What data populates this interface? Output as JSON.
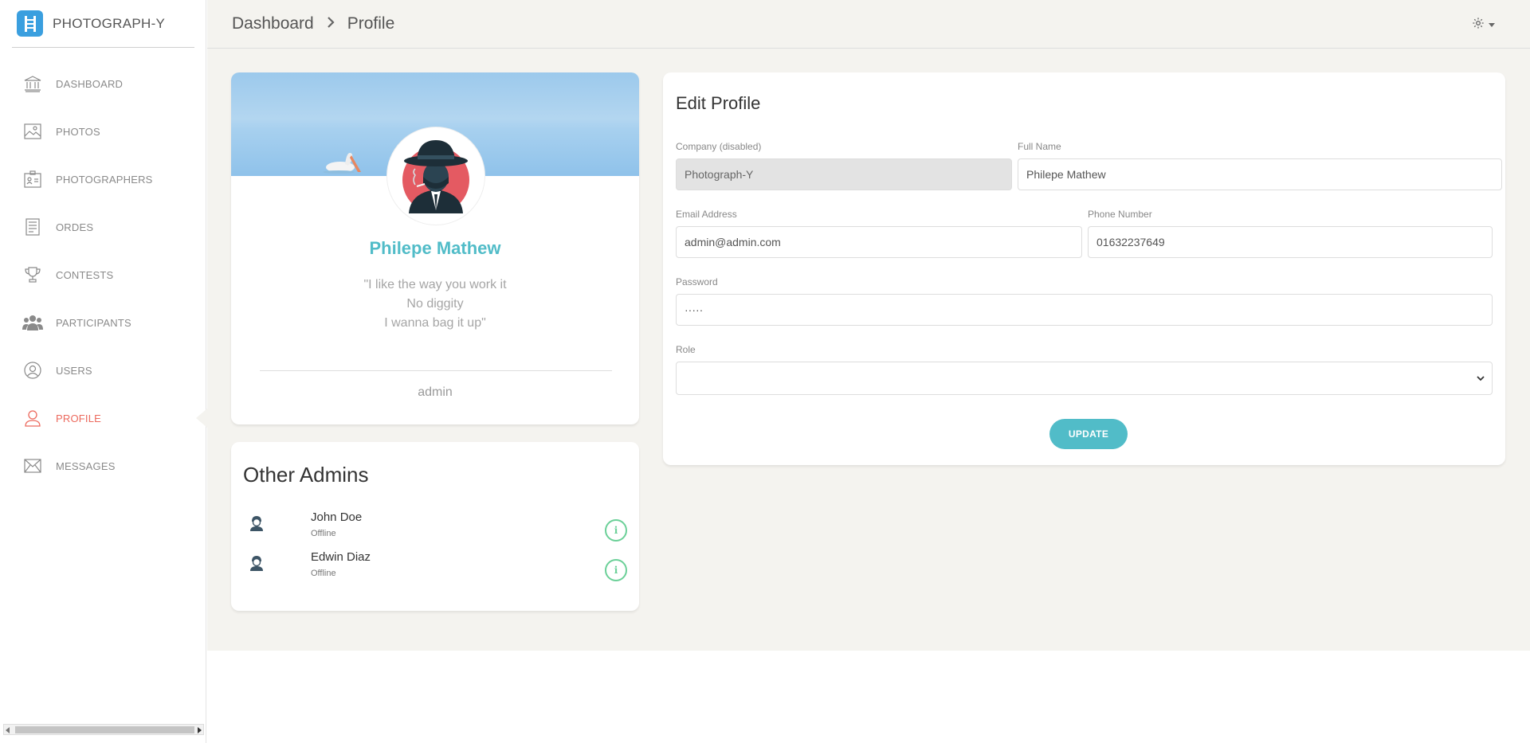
{
  "brand": {
    "name": "PHOTOGRAPH-Y"
  },
  "sidebar": {
    "items": [
      {
        "label": "DASHBOARD",
        "icon": "bank-icon"
      },
      {
        "label": "PHOTOS",
        "icon": "image-icon"
      },
      {
        "label": "PHOTOGRAPHERS",
        "icon": "id-card-icon"
      },
      {
        "label": "ORDES",
        "icon": "document-icon"
      },
      {
        "label": "CONTESTS",
        "icon": "trophy-icon"
      },
      {
        "label": "PARTICIPANTS",
        "icon": "users-group-icon"
      },
      {
        "label": "USERS",
        "icon": "user-circle-icon"
      },
      {
        "label": "PROFILE",
        "icon": "user-icon",
        "active": true
      },
      {
        "label": "MESSAGES",
        "icon": "envelope-icon"
      }
    ]
  },
  "breadcrumb": {
    "root": "Dashboard",
    "current": "Profile"
  },
  "profile": {
    "name": "Philepe Mathew",
    "quote_lines": [
      "\"I like the way you work it",
      "No diggity",
      "I wanna bag it up\""
    ],
    "role": "admin"
  },
  "other_admins": {
    "title": "Other Admins",
    "items": [
      {
        "name": "John Doe",
        "status": "Offline"
      },
      {
        "name": "Edwin Diaz",
        "status": "Offline"
      }
    ]
  },
  "edit_profile": {
    "title": "Edit Profile",
    "company_label": "Company (disabled)",
    "company_value": "Photograph-Y",
    "fullname_label": "Full Name",
    "fullname_value": "Philepe Mathew",
    "email_label": "Email Address",
    "email_value": "admin@admin.com",
    "phone_label": "Phone Number",
    "phone_value": "01632237649",
    "password_label": "Password",
    "password_value": "·····",
    "role_label": "Role",
    "role_value": "",
    "update_label": "UPDATE"
  },
  "colors": {
    "accent": "#51bcc8",
    "active": "#ec6a5e",
    "success": "#6bd098",
    "background": "#f4f3ef"
  }
}
